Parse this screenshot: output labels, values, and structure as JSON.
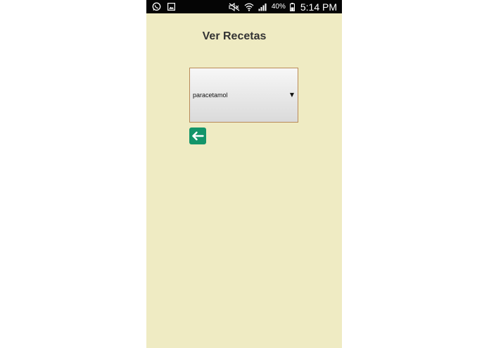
{
  "status_bar": {
    "battery_percent": "40%",
    "time": "5:14 PM",
    "icons": [
      "whatsapp-icon",
      "gallery-notification-icon",
      "mute-icon",
      "wifi-icon",
      "signal-icon",
      "battery-icon"
    ]
  },
  "page": {
    "title": "Ver Recetas"
  },
  "recipe_select": {
    "selected": "paracetamol",
    "arrow": "▼"
  },
  "back_button": {
    "icon": "arrow-left-icon",
    "color": "#13956a"
  },
  "colors": {
    "background": "#efebc3",
    "status_bar": "#050505",
    "select_border": "#b98a58"
  }
}
